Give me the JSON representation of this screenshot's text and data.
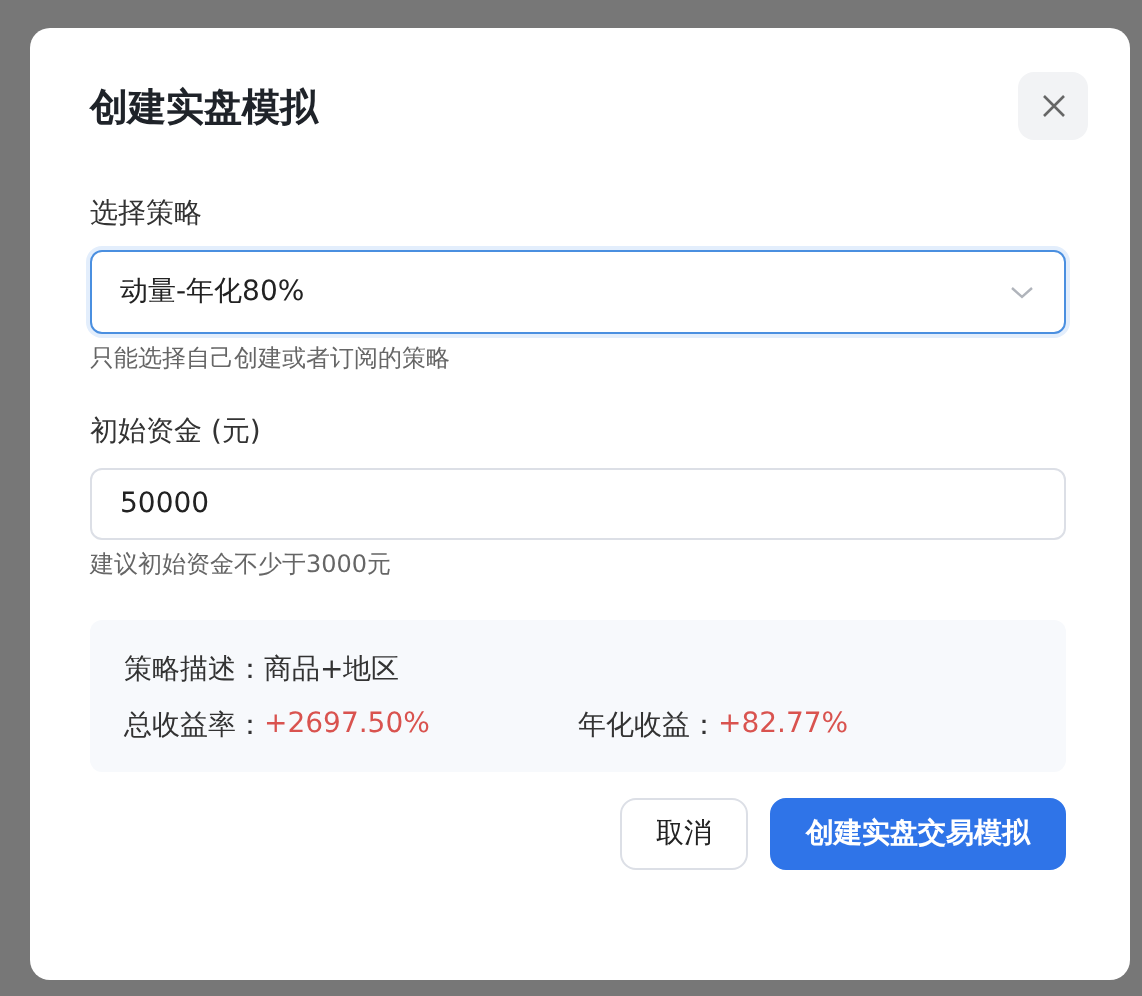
{
  "dialog": {
    "title": "创建实盘模拟"
  },
  "fields": [
    {
      "kind": "select",
      "label": "选择策略",
      "value": "动量-年化80%",
      "hint": "只能选择自己创建或者订阅的策略",
      "focused": true
    },
    {
      "kind": "input",
      "label": "初始资金 (元)",
      "value": "50000",
      "hint": "建议初始资金不少于3000元",
      "focused": false
    }
  ],
  "summary": {
    "description_label": "策略描述：",
    "description": "商品+地区",
    "stats": [
      {
        "label": "总收益率：",
        "value": "+2697.50%"
      },
      {
        "label": "年化收益：",
        "value": "+82.77%"
      }
    ]
  },
  "buttons": [
    {
      "label": "取消",
      "kind": "secondary"
    },
    {
      "label": "创建实盘交易模拟",
      "kind": "primary"
    }
  ]
}
